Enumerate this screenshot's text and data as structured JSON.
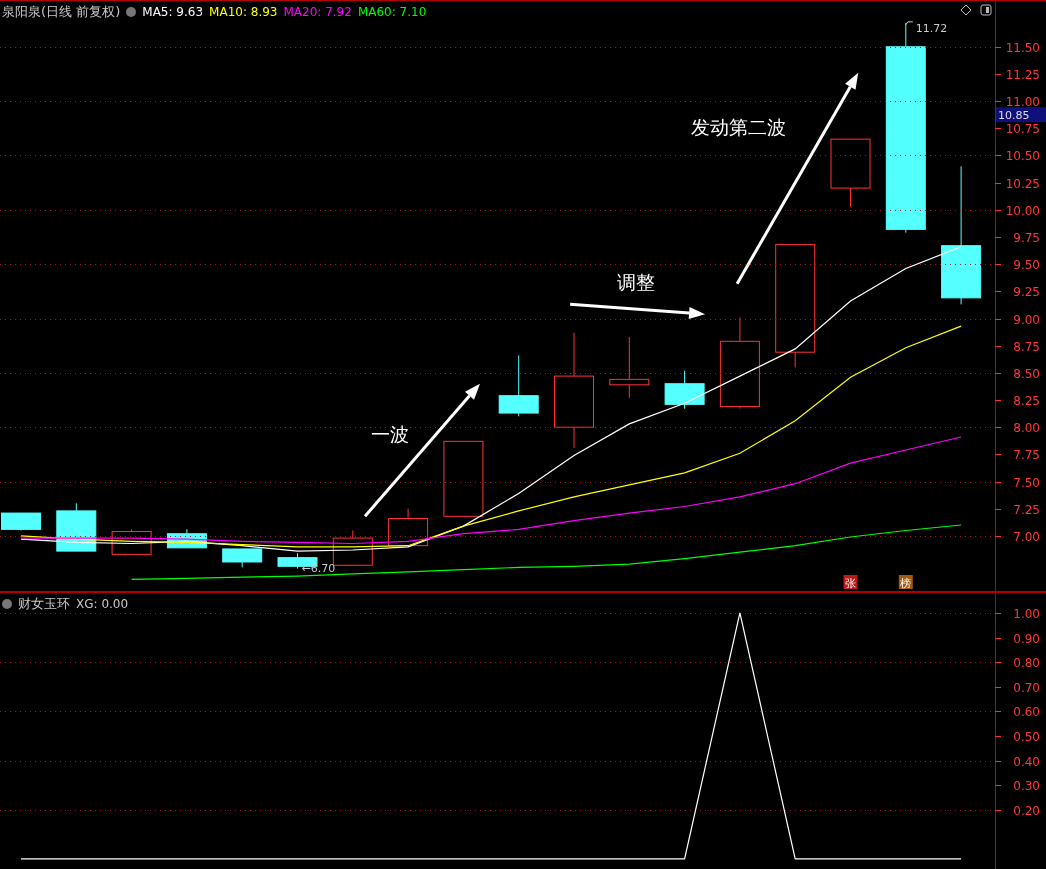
{
  "main_panel": {
    "title": "泉阳泉(日线 前复权)",
    "legend": [
      {
        "text": "MA5: 9.63",
        "color": "#ffffff"
      },
      {
        "text": "MA10: 8.93",
        "color": "#ffff00"
      },
      {
        "text": "MA20: 7.92",
        "color": "#ff00ff"
      },
      {
        "text": "MA60: 7.10",
        "color": "#00ff00"
      }
    ],
    "price_tag": "10.85",
    "badges": [
      {
        "text": "张",
        "color": "#c01818"
      },
      {
        "text": "榜",
        "color": "#a05a14"
      }
    ],
    "chart_data": {
      "type": "line",
      "grid": true,
      "ylim": [
        6.493,
        11.921
      ],
      "yticks": [
        {
          "value": 7,
          "label": "7.00"
        },
        {
          "value": 7.25,
          "label": "7.25"
        },
        {
          "value": 7.5,
          "label": "7.50"
        },
        {
          "value": 7.75,
          "label": "7.75"
        },
        {
          "value": 8,
          "label": "8.00"
        },
        {
          "value": 8.25,
          "label": "8.25"
        },
        {
          "value": 8.5,
          "label": "8.50"
        },
        {
          "value": 8.75,
          "label": "8.75"
        },
        {
          "value": 9,
          "label": "9.00"
        },
        {
          "value": 9.25,
          "label": "9.25"
        },
        {
          "value": 9.5,
          "label": "9.50"
        },
        {
          "value": 9.75,
          "label": "9.75"
        },
        {
          "value": 10,
          "label": "10.00"
        },
        {
          "value": 10.25,
          "label": "10.25"
        },
        {
          "value": 10.5,
          "label": "10.50"
        },
        {
          "value": 10.75,
          "label": "10.75"
        },
        {
          "value": 11,
          "label": "11.00"
        },
        {
          "value": 11.25,
          "label": "11.25"
        },
        {
          "value": 11.5,
          "label": "11.50"
        }
      ],
      "series": [
        {
          "color": "#ffffff",
          "values": [
            6.97,
            6.94,
            6.93,
            6.95,
            6.91,
            6.86,
            6.87,
            6.9,
            7.09,
            7.39,
            7.74,
            8.03,
            8.22,
            8.47,
            8.72,
            9.16,
            9.46,
            9.66
          ]
        },
        {
          "color": "#ffff00",
          "values": [
            7.0,
            6.97,
            6.95,
            6.94,
            6.92,
            6.9,
            6.9,
            6.91,
            7.09,
            7.23,
            7.36,
            7.47,
            7.58,
            7.76,
            8.06,
            8.46,
            8.73,
            8.93
          ]
        },
        {
          "color": "#ff00ff",
          "values": [
            6.98,
            6.98,
            6.98,
            6.97,
            6.95,
            6.94,
            6.93,
            6.95,
            7.02,
            7.06,
            7.14,
            7.21,
            7.27,
            7.36,
            7.48,
            7.67,
            7.79,
            7.91
          ]
        },
        {
          "color": "#00ff00",
          "values": [
            null,
            null,
            6.6,
            6.61,
            6.62,
            6.63,
            6.65,
            6.67,
            6.69,
            6.71,
            6.72,
            6.74,
            6.79,
            6.85,
            6.91,
            6.99,
            7.05,
            7.1
          ]
        }
      ],
      "annotations": [
        "一波",
        "调整",
        "发动第二波",
        "11.72",
        "←6.70"
      ]
    }
  },
  "indicator_panel": {
    "title": "财女玉环",
    "readout": "XG: 0.00",
    "chart_data": {
      "type": "line",
      "grid": true,
      "ylim": [
        -0.045,
        1.081
      ],
      "yticks": [
        {
          "value": 0.2,
          "label": "0.20"
        },
        {
          "value": 0.3,
          "label": "0.30"
        },
        {
          "value": 0.4,
          "label": "0.40"
        },
        {
          "value": 0.5,
          "label": "0.50"
        },
        {
          "value": 0.6,
          "label": "0.60"
        },
        {
          "value": 0.7,
          "label": "0.70"
        },
        {
          "value": 0.8,
          "label": "0.80"
        },
        {
          "value": 0.9,
          "label": "0.90"
        },
        {
          "value": 1,
          "label": "1.00"
        }
      ],
      "series": [
        {
          "color": "#ffffff",
          "values": [
            0,
            0,
            0,
            0,
            0,
            0,
            0,
            0,
            0,
            0,
            0,
            0,
            0,
            1,
            0,
            0,
            0,
            0
          ]
        }
      ]
    }
  }
}
